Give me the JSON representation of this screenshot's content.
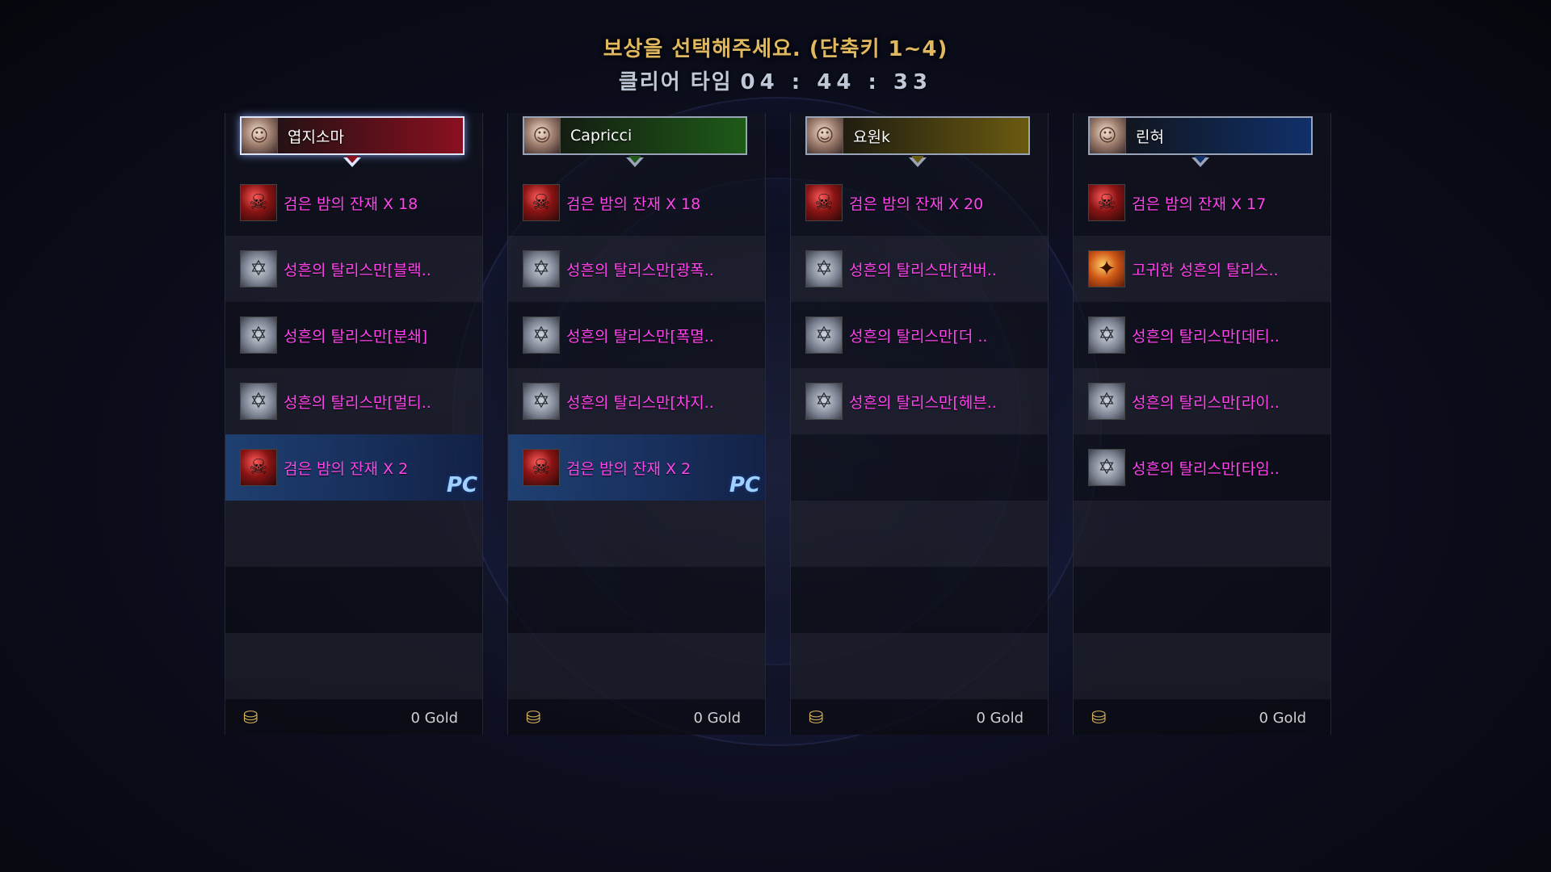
{
  "header": {
    "title": "보상을 선택해주세요. (단축키 1~4)",
    "time_label": "클리어 타임",
    "time_value": "04 : 44 : 33"
  },
  "players": [
    {
      "name": "엽지소마",
      "banner_color": "#8a1020",
      "selected": true,
      "rewards": [
        {
          "label": "검은 밤의 잔재 X 18",
          "icon": "shard-icon",
          "pc": false
        },
        {
          "label": "성흔의 탈리스만[블랙..",
          "icon": "talisman-icon",
          "pc": false
        },
        {
          "label": "성흔의 탈리스만[분쇄]",
          "icon": "talisman-icon",
          "pc": false
        },
        {
          "label": "성흔의 탈리스만[멀티..",
          "icon": "talisman-icon",
          "pc": false
        },
        {
          "label": "검은 밤의 잔재 X 2",
          "icon": "shard-icon",
          "pc": true
        }
      ],
      "gold": "0 Gold"
    },
    {
      "name": "Capricci",
      "banner_color": "#1e5a18",
      "selected": false,
      "rewards": [
        {
          "label": "검은 밤의 잔재 X 18",
          "icon": "shard-icon",
          "pc": false
        },
        {
          "label": "성흔의 탈리스만[광폭..",
          "icon": "talisman-icon",
          "pc": false
        },
        {
          "label": "성흔의 탈리스만[폭멸..",
          "icon": "talisman-icon",
          "pc": false
        },
        {
          "label": "성흔의 탈리스만[차지..",
          "icon": "talisman-icon",
          "pc": false
        },
        {
          "label": "검은 밤의 잔재 X 2",
          "icon": "shard-icon",
          "pc": true
        }
      ],
      "gold": "0 Gold"
    },
    {
      "name": "요원k",
      "banner_color": "#6a5a10",
      "selected": false,
      "rewards": [
        {
          "label": "검은 밤의 잔재 X 20",
          "icon": "shard-icon",
          "pc": false
        },
        {
          "label": "성흔의 탈리스만[컨버..",
          "icon": "talisman-icon",
          "pc": false
        },
        {
          "label": "성흔의 탈리스만[더 ..",
          "icon": "talisman-icon",
          "pc": false
        },
        {
          "label": "성흔의 탈리스만[헤븐..",
          "icon": "talisman-icon",
          "pc": false
        }
      ],
      "gold": "0 Gold"
    },
    {
      "name": "린혀",
      "banner_color": "#10306a",
      "selected": false,
      "rewards": [
        {
          "label": "검은 밤의 잔재 X 17",
          "icon": "shard-icon",
          "pc": false
        },
        {
          "label": "고귀한 성흔의 탈리스..",
          "icon": "noble-talisman-icon",
          "pc": false
        },
        {
          "label": "성흔의 탈리스만[데티..",
          "icon": "talisman-icon",
          "pc": false
        },
        {
          "label": "성흔의 탈리스만[라이..",
          "icon": "talisman-icon",
          "pc": false
        },
        {
          "label": "성흔의 탈리스만[타임..",
          "icon": "talisman-icon",
          "pc": false
        }
      ],
      "gold": "0 Gold"
    }
  ],
  "pc_tag": "PC",
  "colors": {
    "title": "#e0b860",
    "reward_text": "#ff44ee",
    "pc_highlight": "#2a5aa0"
  }
}
